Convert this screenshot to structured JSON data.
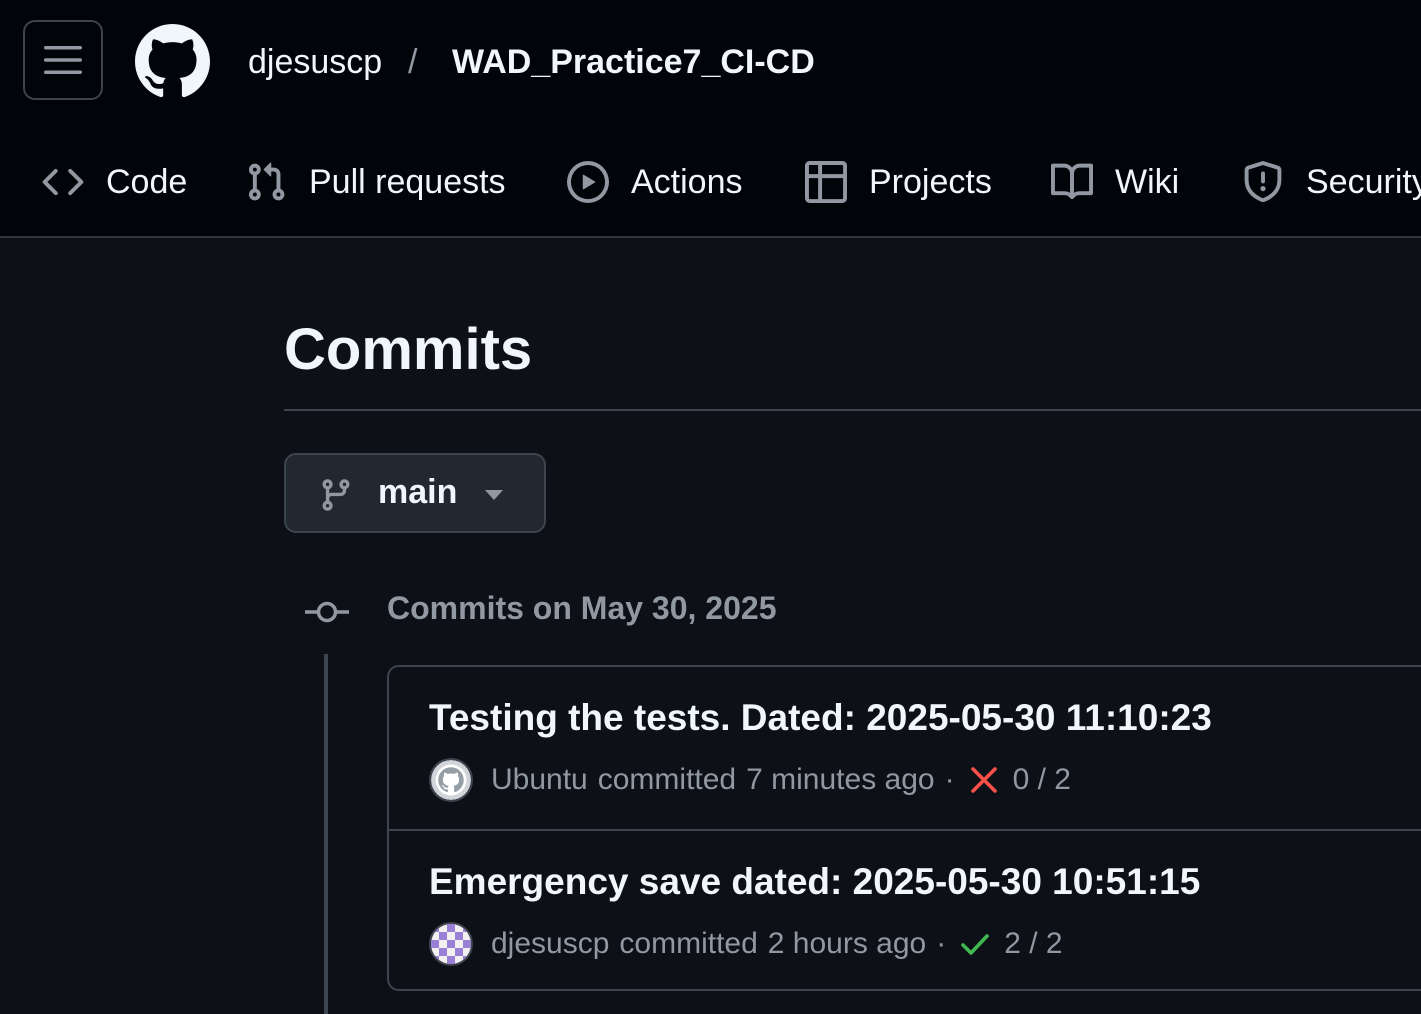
{
  "header": {
    "owner": "djesuscp",
    "separator": "/",
    "repo": "WAD_Practice7_CI-CD"
  },
  "nav": {
    "tabs": [
      {
        "label": "Code",
        "icon": "code-icon"
      },
      {
        "label": "Pull requests",
        "icon": "git-pull-request-icon"
      },
      {
        "label": "Actions",
        "icon": "play-icon"
      },
      {
        "label": "Projects",
        "icon": "table-icon"
      },
      {
        "label": "Wiki",
        "icon": "book-icon"
      },
      {
        "label": "Security",
        "icon": "shield-icon"
      }
    ]
  },
  "page": {
    "title": "Commits",
    "branch": "main",
    "group_title": "Commits on May 30, 2025"
  },
  "commits": [
    {
      "message": "Testing the tests. Dated: 2025-05-30 11:10:23",
      "author": "Ubuntu",
      "action": "committed",
      "time": "7 minutes ago",
      "separator": "·",
      "status": "failure",
      "checks": "0 / 2",
      "avatar": "github-default-avatar"
    },
    {
      "message": "Emergency save dated: 2025-05-30 10:51:15",
      "author": "djesuscp",
      "action": "committed",
      "time": "2 hours ago",
      "separator": "·",
      "status": "success",
      "checks": "2 / 2",
      "avatar": "identicon-avatar"
    }
  ],
  "colors": {
    "background": "#0d1117",
    "header_background": "#010409",
    "border": "#3d444d",
    "muted_text": "#9198a1",
    "failure": "#f85149",
    "success": "#3fb950"
  }
}
